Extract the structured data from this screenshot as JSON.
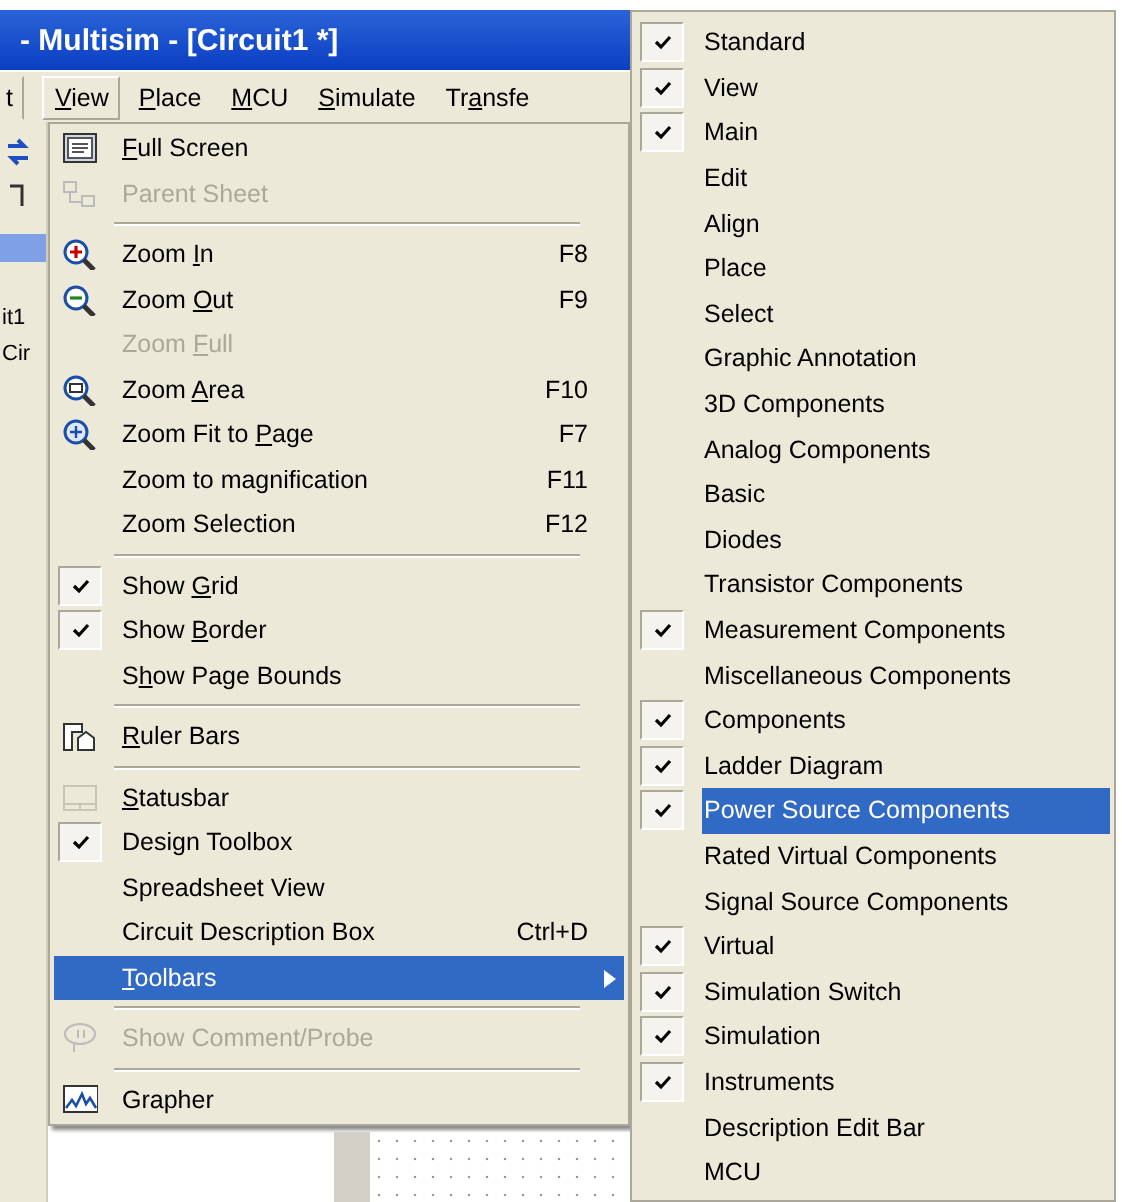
{
  "window": {
    "title": "- Multisim - [Circuit1 *]"
  },
  "menubar": [
    {
      "label": [
        "t"
      ],
      "selected": false
    },
    {
      "label": [
        "V",
        "iew"
      ],
      "selected": true
    },
    {
      "label": [
        "P",
        "lace"
      ],
      "selected": false
    },
    {
      "label": [
        "M",
        "CU"
      ],
      "selected": false
    },
    {
      "label": [
        "S",
        "imulate"
      ],
      "selected": false
    },
    {
      "label": [
        "Tr",
        "a",
        "nsfe"
      ],
      "selected": false
    }
  ],
  "background_texts": [
    "it1",
    "Cir"
  ],
  "view_menu": [
    {
      "kind": "item",
      "label": [
        "F",
        "ull Screen"
      ],
      "checked": false,
      "disabled": false,
      "selected": false
    },
    {
      "kind": "item",
      "label": [
        "Parent Sheet"
      ],
      "checked": false,
      "disabled": true,
      "selected": false
    },
    {
      "kind": "separator"
    },
    {
      "kind": "item",
      "label": [
        "Zoom ",
        "I",
        "n"
      ],
      "shortcut": "F8",
      "checked": false,
      "disabled": false,
      "selected": false
    },
    {
      "kind": "item",
      "label": [
        "Zoom ",
        "O",
        "ut"
      ],
      "shortcut": "F9",
      "checked": false,
      "disabled": false,
      "selected": false
    },
    {
      "kind": "item",
      "label": [
        "Zoom ",
        "F",
        "ull"
      ],
      "checked": false,
      "disabled": true,
      "selected": false
    },
    {
      "kind": "item",
      "label": [
        "Zoom ",
        "A",
        "rea"
      ],
      "shortcut": "F10",
      "checked": false,
      "disabled": false,
      "selected": false
    },
    {
      "kind": "item",
      "label": [
        "Zoom Fit to ",
        "P",
        "age"
      ],
      "shortcut": "F7",
      "checked": false,
      "disabled": false,
      "selected": false
    },
    {
      "kind": "item",
      "label": [
        "Zoom to magnification"
      ],
      "shortcut": "F11",
      "checked": false,
      "disabled": false,
      "selected": false
    },
    {
      "kind": "item",
      "label": [
        "Zoom Selection"
      ],
      "shortcut": "F12",
      "checked": false,
      "disabled": false,
      "selected": false
    },
    {
      "kind": "separator"
    },
    {
      "kind": "item",
      "label": [
        "Show ",
        "G",
        "rid"
      ],
      "checked": true,
      "disabled": false,
      "selected": false
    },
    {
      "kind": "item",
      "label": [
        "Show ",
        "B",
        "order"
      ],
      "checked": true,
      "disabled": false,
      "selected": false
    },
    {
      "kind": "item",
      "label": [
        "S",
        "h",
        "ow Page Bounds"
      ],
      "checked": false,
      "disabled": false,
      "selected": false
    },
    {
      "kind": "separator"
    },
    {
      "kind": "item",
      "label": [
        "R",
        "uler Bars"
      ],
      "checked": false,
      "disabled": false,
      "selected": false
    },
    {
      "kind": "separator"
    },
    {
      "kind": "item",
      "label": [
        "S",
        "tatusbar"
      ],
      "checked": false,
      "disabled": false,
      "selected": false
    },
    {
      "kind": "item",
      "label": [
        "Design Toolbox"
      ],
      "checked": true,
      "disabled": false,
      "selected": false
    },
    {
      "kind": "item",
      "label": [
        "Spreadsheet View"
      ],
      "checked": false,
      "disabled": false,
      "selected": false
    },
    {
      "kind": "item",
      "label": [
        "Circuit Description Box"
      ],
      "shortcut": "Ctrl+D",
      "checked": false,
      "disabled": false,
      "selected": false
    },
    {
      "kind": "item",
      "label": [
        "T",
        "oolbars"
      ],
      "submenu": true,
      "checked": false,
      "disabled": false,
      "selected": true
    },
    {
      "kind": "separator"
    },
    {
      "kind": "item",
      "label": [
        "Show Comment/Probe"
      ],
      "checked": false,
      "disabled": true,
      "selected": false
    },
    {
      "kind": "separator"
    },
    {
      "kind": "item",
      "label": [
        "Grapher"
      ],
      "checked": false,
      "disabled": false,
      "selected": false
    }
  ],
  "toolbars_submenu": [
    {
      "label": "Standard",
      "checked": true,
      "selected": false
    },
    {
      "label": "View",
      "checked": true,
      "selected": false
    },
    {
      "label": "Main",
      "checked": true,
      "selected": false
    },
    {
      "label": "Edit",
      "checked": false,
      "selected": false
    },
    {
      "label": "Align",
      "checked": false,
      "selected": false
    },
    {
      "label": "Place",
      "checked": false,
      "selected": false
    },
    {
      "label": "Select",
      "checked": false,
      "selected": false
    },
    {
      "label": "Graphic Annotation",
      "checked": false,
      "selected": false
    },
    {
      "label": "3D Components",
      "checked": false,
      "selected": false
    },
    {
      "label": "Analog Components",
      "checked": false,
      "selected": false
    },
    {
      "label": "Basic",
      "checked": false,
      "selected": false
    },
    {
      "label": "Diodes",
      "checked": false,
      "selected": false
    },
    {
      "label": "Transistor Components",
      "checked": false,
      "selected": false
    },
    {
      "label": "Measurement Components",
      "checked": true,
      "selected": false
    },
    {
      "label": "Miscellaneous Components",
      "checked": false,
      "selected": false
    },
    {
      "label": "Components",
      "checked": true,
      "selected": false
    },
    {
      "label": "Ladder Diagram",
      "checked": true,
      "selected": false
    },
    {
      "label": "Power Source Components",
      "checked": true,
      "selected": true
    },
    {
      "label": "Rated Virtual Components",
      "checked": false,
      "selected": false
    },
    {
      "label": "Signal Source Components",
      "checked": false,
      "selected": false
    },
    {
      "label": "Virtual",
      "checked": true,
      "selected": false
    },
    {
      "label": "Simulation Switch",
      "checked": true,
      "selected": false
    },
    {
      "label": "Simulation",
      "checked": true,
      "selected": false
    },
    {
      "label": "Instruments",
      "checked": true,
      "selected": false
    },
    {
      "label": "Description Edit Bar",
      "checked": false,
      "selected": false
    },
    {
      "label": "MCU",
      "checked": false,
      "selected": false
    }
  ]
}
